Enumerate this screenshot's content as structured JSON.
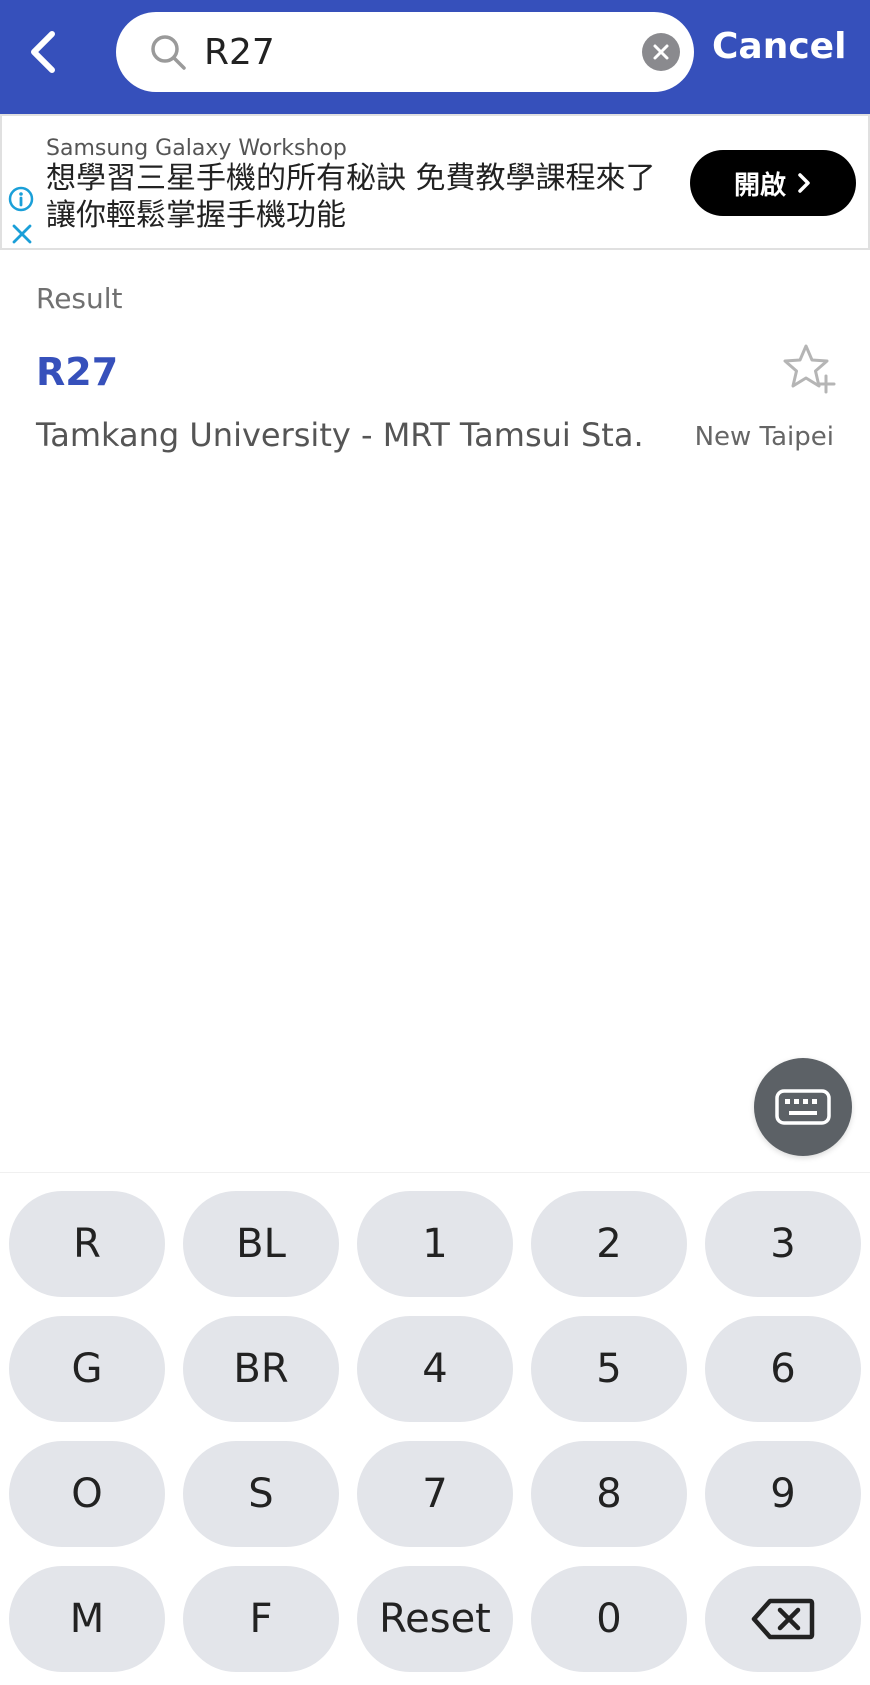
{
  "header": {
    "search_value": "R27",
    "cancel_label": "Cancel"
  },
  "ad": {
    "brand": "Samsung Galaxy Workshop",
    "text": "想學習三星手機的所有秘訣 免費教學課程來了 讓你輕鬆掌握手機功能",
    "button_label": "開啟"
  },
  "results": {
    "label": "Result",
    "items": [
      {
        "code": "R27",
        "name": "Tamkang University - MRT Tamsui Sta.",
        "city": "New Taipei"
      }
    ]
  },
  "keypad": {
    "rows": [
      [
        "R",
        "BL",
        "1",
        "2",
        "3"
      ],
      [
        "G",
        "BR",
        "4",
        "5",
        "6"
      ],
      [
        "O",
        "S",
        "7",
        "8",
        "9"
      ],
      [
        "M",
        "F",
        "Reset",
        "0",
        ""
      ]
    ]
  },
  "colors": {
    "header_bg": "#3650bb",
    "accent": "#3650bb",
    "key_bg": "#e3e5ea"
  }
}
